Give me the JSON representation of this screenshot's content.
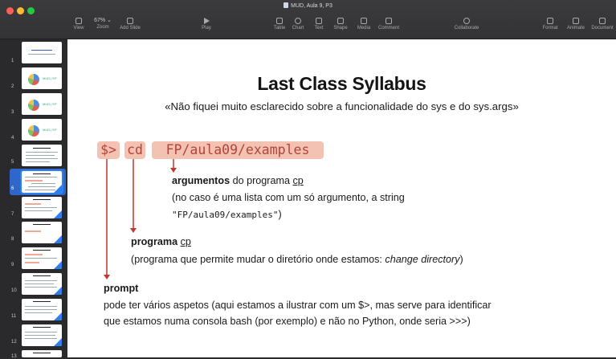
{
  "window": {
    "title": "MUD, Aula 9, P3"
  },
  "toolbar": {
    "view_label": "View",
    "zoom_value": "67% ⌄",
    "zoom_label": "Zoom",
    "add_slide_label": "Add Slide",
    "play_label": "Play",
    "table_label": "Table",
    "chart_label": "Chart",
    "text_label": "Text",
    "shape_label": "Shape",
    "media_label": "Media",
    "comment_label": "Comment",
    "collaborate_label": "Collaborate",
    "format_label": "Format",
    "animate_label": "Animate",
    "document_label": "Document"
  },
  "navigator": {
    "slide_numbers": [
      "1",
      "2",
      "3",
      "4",
      "5",
      "6",
      "7",
      "8",
      "9",
      "10",
      "11",
      "12",
      "13"
    ],
    "selected_slide": "6",
    "thumb_text": "MUD | EP"
  },
  "slide": {
    "title": "Last Class Syllabus",
    "subtitle": "«Não fiquei muito esclarecido sobre a funcionalidade do sys e do sys.args»",
    "command_prompt": "$>",
    "command_program": "cd",
    "command_argument": "FP/aula09/examples",
    "argumentos_bold": "argumentos",
    "argumentos_mid": " do programa ",
    "argumentos_cp": "cp",
    "argumentos_line2": "(no caso é uma lista com um só argumento, a string",
    "argumentos_line3_string": "\"FP/aula09/examples\"",
    "argumentos_line3_end": ")",
    "programa_bold": "programa",
    "programa_cp": "cp",
    "programa_line2_start": "(programa que permite mudar o diretório onde estamos: ",
    "programa_line2_italic": "change directory",
    "programa_line2_end": ")",
    "prompt_bold": "prompt",
    "prompt_line2": "pode ter vários aspetos (aqui estamos a ilustrar com um $>, mas serve para identificar",
    "prompt_line3": "que estamos numa consola bash (por exemplo) e não no Python, onde seria >>>)"
  },
  "colors": {
    "highlight": "#f4c2b3",
    "command_text": "#b2443a",
    "pointer": "#c0392b",
    "selection": "#2f7ff0"
  }
}
